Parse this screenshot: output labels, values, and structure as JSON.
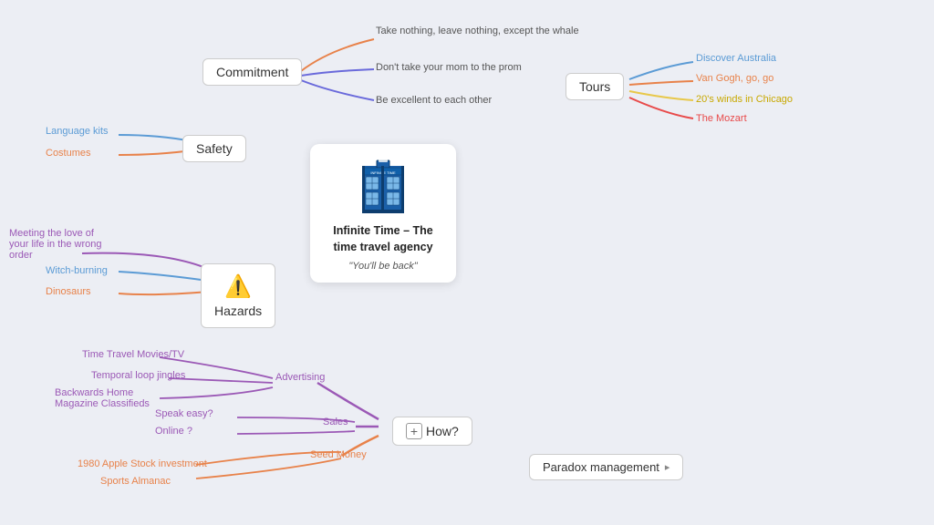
{
  "nodes": {
    "commitment": {
      "label": "Commitment"
    },
    "safety": {
      "label": "Safety"
    },
    "hazards": {
      "label": "Hazards"
    },
    "tours": {
      "label": "Tours"
    },
    "how": {
      "label": "How?"
    },
    "paradox": {
      "label": "Paradox management"
    }
  },
  "card": {
    "title": "Infinite Time – The time travel agency",
    "subtitle": "\"You'll be back\""
  },
  "commitment_branches": [
    {
      "text": "Take nothing, leave nothing, except the whale",
      "color": "#e8824a"
    },
    {
      "text": "Don't take your mom to the prom",
      "color": "#6a6adb"
    },
    {
      "text": "Be excellent to each other",
      "color": "#6a6adb"
    }
  ],
  "safety_branches": [
    {
      "text": "Language kits",
      "color": "#5b9bd5"
    },
    {
      "text": "Costumes",
      "color": "#e8824a"
    }
  ],
  "hazards_branches": [
    {
      "text": "Meeting the love of your life in the wrong order",
      "color": "#9b59b6",
      "multiline": true
    },
    {
      "text": "Witch-burning",
      "color": "#5b9bd5"
    },
    {
      "text": "Dinosaurs",
      "color": "#e8824a"
    }
  ],
  "tours_branches": [
    {
      "text": "Discover Australia",
      "color": "#5b9bd5"
    },
    {
      "text": "Van Gogh, go, go",
      "color": "#e8824a"
    },
    {
      "text": "20's winds in Chicago",
      "color": "#e8c84a"
    },
    {
      "text": "The Mozart",
      "color": "#e84a4a"
    }
  ],
  "how_branches": {
    "advertising": {
      "label": "Advertising",
      "sub": [
        {
          "text": "Time Travel Movies/TV",
          "color": "#9b59b6"
        },
        {
          "text": "Temporal loop jingles",
          "color": "#9b59b6"
        },
        {
          "text": "Backwards Home Magazine Classifieds",
          "color": "#9b59b6"
        }
      ]
    },
    "sales": {
      "label": "Sales",
      "sub": [
        {
          "text": "Speak easy?",
          "color": "#9b59b6"
        },
        {
          "text": "Online ?",
          "color": "#9b59b6"
        }
      ]
    },
    "seed_money": {
      "label": "Seed Money",
      "sub": [
        {
          "text": "1980 Apple Stock investment",
          "color": "#e8824a"
        },
        {
          "text": "Sports Almanac",
          "color": "#e8824a"
        }
      ]
    }
  }
}
